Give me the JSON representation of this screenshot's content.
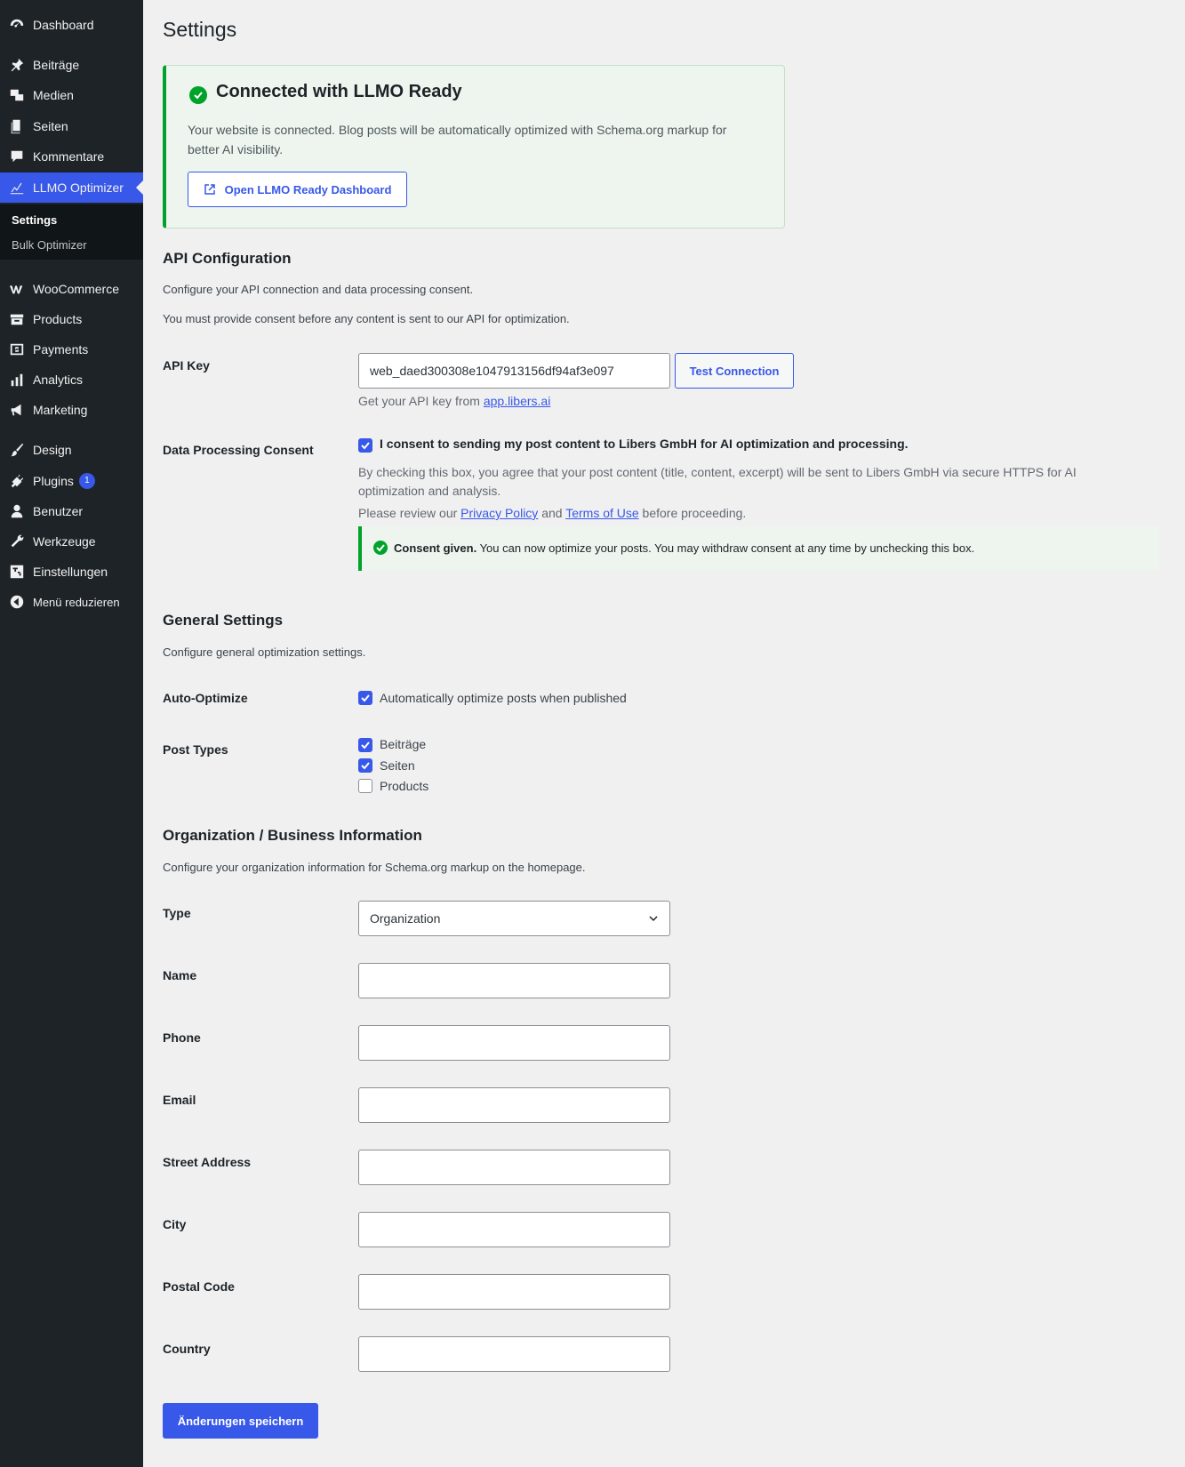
{
  "sidebar": {
    "items": [
      {
        "label": "Dashboard",
        "icon": "dashboard-icon"
      },
      {
        "label": "Beiträge",
        "icon": "pin-icon"
      },
      {
        "label": "Medien",
        "icon": "media-icon"
      },
      {
        "label": "Seiten",
        "icon": "pages-icon"
      },
      {
        "label": "Kommentare",
        "icon": "comment-icon"
      },
      {
        "label": "LLMO Optimizer",
        "icon": "chart-line-icon"
      },
      {
        "label": "WooCommerce",
        "icon": "woocommerce-icon"
      },
      {
        "label": "Products",
        "icon": "archive-icon"
      },
      {
        "label": "Payments",
        "icon": "payments-icon"
      },
      {
        "label": "Analytics",
        "icon": "bar-chart-icon"
      },
      {
        "label": "Marketing",
        "icon": "megaphone-icon"
      },
      {
        "label": "Design",
        "icon": "brush-icon"
      },
      {
        "label": "Plugins",
        "icon": "plugin-icon",
        "badge": "1"
      },
      {
        "label": "Benutzer",
        "icon": "user-icon"
      },
      {
        "label": "Werkzeuge",
        "icon": "wrench-icon"
      },
      {
        "label": "Einstellungen",
        "icon": "settings-icon"
      },
      {
        "label": "Menü reduzieren",
        "icon": "collapse-icon"
      }
    ],
    "submenu": [
      {
        "label": "Settings"
      },
      {
        "label": "Bulk Optimizer"
      }
    ]
  },
  "page": {
    "title": "Settings"
  },
  "notice": {
    "title": "Connected with LLMO Ready",
    "text": "Your website is connected. Blog posts will be automatically optimized with Schema.org markup for better AI visibility.",
    "button": "Open LLMO Ready Dashboard"
  },
  "api": {
    "heading": "API Configuration",
    "desc1": "Configure your API connection and data processing consent.",
    "desc2": "You must provide consent before any content is sent to our API for optimization.",
    "key_label": "API Key",
    "key_value": "web_daed300308e1047913156df94af3e097",
    "test_button": "Test Connection",
    "help_prefix": "Get your API key from ",
    "help_link": "app.libers.ai",
    "consent_label": "Data Processing Consent",
    "consent_checkbox": "I consent to sending my post content to Libers GmbH for AI optimization and processing.",
    "consent_help1": "By checking this box, you agree that your post content (title, content, excerpt) will be sent to Libers GmbH via secure HTTPS for AI optimization and analysis.",
    "consent_help2_prefix": "Please review our ",
    "privacy_link": "Privacy Policy",
    "consent_help2_and": " and ",
    "terms_link": "Terms of Use",
    "consent_help2_suffix": " before proceeding.",
    "consent_notice_bold": "Consent given.",
    "consent_notice_text": " You can now optimize your posts. You may withdraw consent at any time by unchecking this box."
  },
  "general": {
    "heading": "General Settings",
    "desc": "Configure general optimization settings.",
    "auto_label": "Auto-Optimize",
    "auto_checkbox": "Automatically optimize posts when published",
    "post_types_label": "Post Types",
    "post_types": [
      {
        "label": "Beiträge",
        "checked": true
      },
      {
        "label": "Seiten",
        "checked": true
      },
      {
        "label": "Products",
        "checked": false
      }
    ]
  },
  "org": {
    "heading": "Organization / Business Information",
    "desc": "Configure your organization information for Schema.org markup on the homepage.",
    "type_label": "Type",
    "type_value": "Organization",
    "fields": [
      {
        "label": "Name",
        "value": ""
      },
      {
        "label": "Phone",
        "value": ""
      },
      {
        "label": "Email",
        "value": ""
      },
      {
        "label": "Street Address",
        "value": ""
      },
      {
        "label": "City",
        "value": ""
      },
      {
        "label": "Postal Code",
        "value": ""
      },
      {
        "label": "Country",
        "value": ""
      }
    ]
  },
  "save_button": "Änderungen speichern",
  "colors": {
    "accent": "#3858e9",
    "success": "#00a32a",
    "sidebar_bg": "#1d2327"
  }
}
